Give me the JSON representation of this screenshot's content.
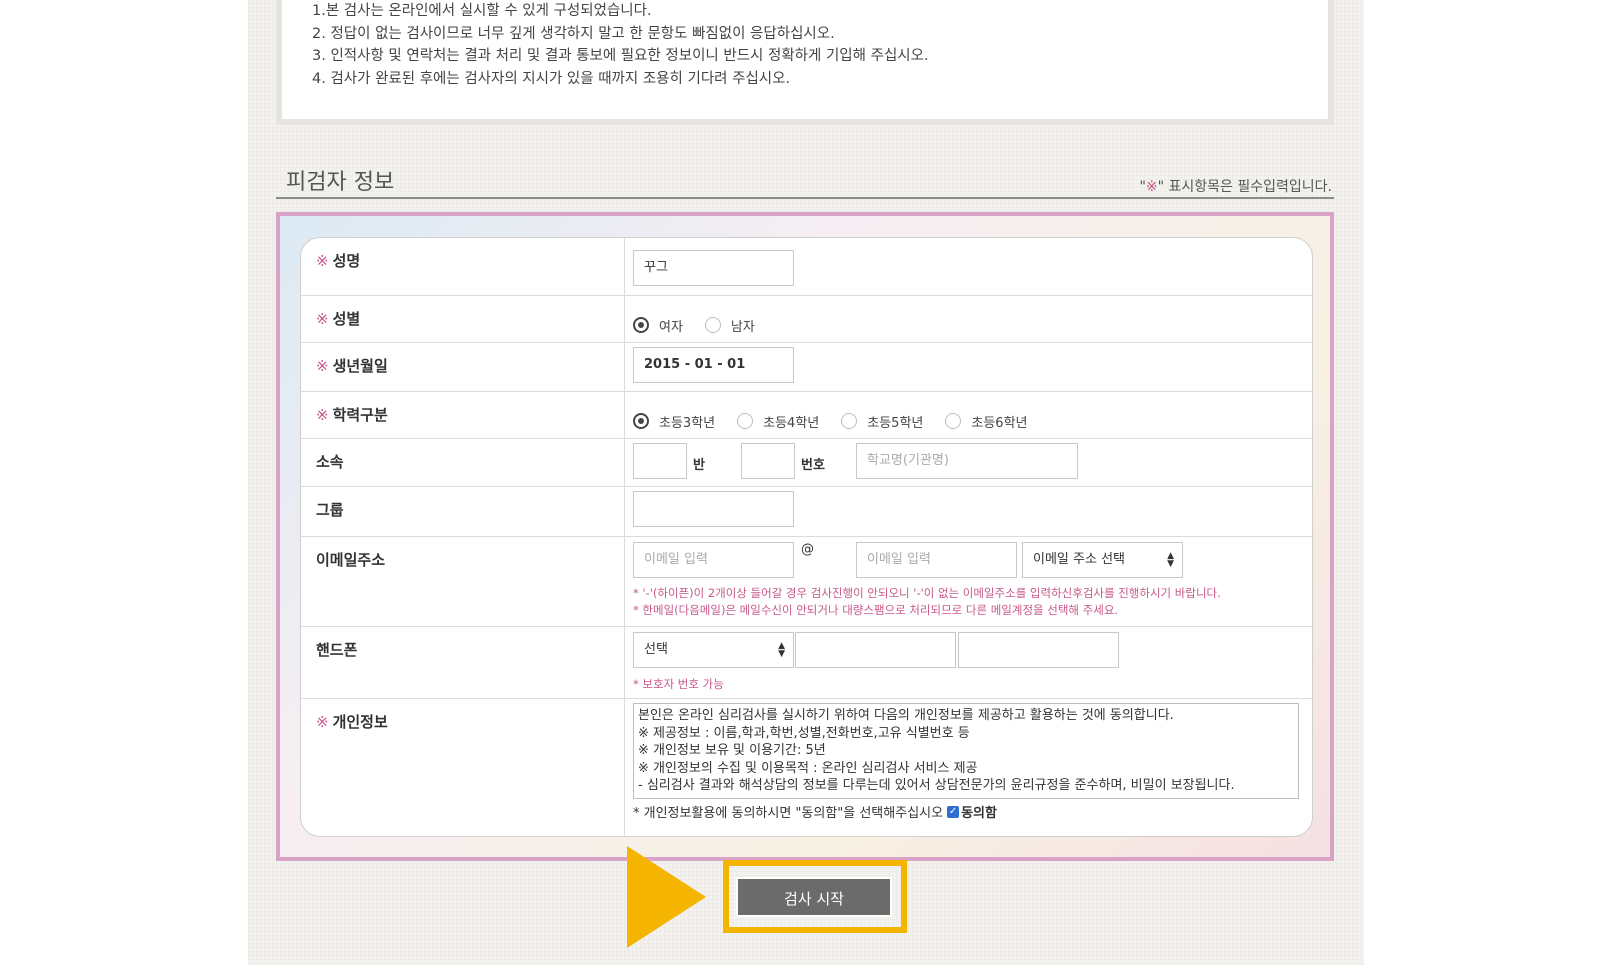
{
  "instructions": [
    "1.본 검사는 온라인에서 실시할 수 있게 구성되었습니다.",
    "2. 정답이 없는 검사이므로 너무 깊게 생각하지 말고 한 문항도 빠짐없이 응답하십시오.",
    "3. 인적사항 및 연락처는 결과 처리 및 결과 통보에 필요한 정보이니 반드시 정확하게 기입해 주십시오.",
    "4. 검사가 완료된 후에는 검사자의 지시가 있을 때까지 조용히 기다려 주십시오."
  ],
  "section": {
    "title": "피검자 정보",
    "note_prefix": "\"",
    "note_mark": "※",
    "note_suffix": "\" 표시항목은 필수입력입니다."
  },
  "required_mark": "※",
  "form": {
    "name": {
      "label": "성명",
      "value": "꾸그"
    },
    "gender": {
      "label": "성별",
      "options": [
        "여자",
        "남자"
      ],
      "selected": "여자"
    },
    "birth": {
      "label": "생년월일",
      "value": "2015 - 01 - 01"
    },
    "grade": {
      "label": "학력구분",
      "options": [
        "초등3학년",
        "초등4학년",
        "초등5학년",
        "초등6학년"
      ],
      "selected": "초등3학년"
    },
    "affiliation": {
      "label": "소속",
      "class_suffix": "반",
      "number_suffix": "번호",
      "school_placeholder": "학교명(기관명)"
    },
    "group": {
      "label": "그룹"
    },
    "email": {
      "label": "이메일주소",
      "id_placeholder": "이메일 입력",
      "at": "@",
      "domain_placeholder": "이메일 입력",
      "select_value": "이메일 주소 선택",
      "note1": "* '-'(하이픈)이 2개이상 들어갈 경우 검사진행이 안되오니 '-'이 없는 이메일주소를 입력하신후검사를 진행하시기 바랍니다.",
      "note2": "* 한메일(다음메일)은 메일수신이 안되거나 대량스팸으로 처리되므로 다른 메일계정을 선택해 주세요."
    },
    "phone": {
      "label": "핸드폰",
      "select_value": "선택",
      "note": "* 보호자 번호 가능"
    },
    "privacy": {
      "label": "개인정보",
      "lines": [
        "본인은 온라인 심리검사를 실시하기 위하여 다음의 개인정보를 제공하고 활용하는 것에 동의합니다.",
        "※ 제공정보 : 이름,학과,학번,성별,전화번호,고유 식별번호 등",
        "※ 개인정보 보유 및 이용기간: 5년",
        "※ 개인정보의 수집 및 이용목적 : 온라인 심리검사 서비스 제공",
        "- 심리검사 결과와 해석상담의 정보를 다루는데 있어서 상담전문가의 윤리규정을 준수하며, 비밀이 보장됩니다."
      ],
      "agree_text": "* 개인정보활용에 동의하시면 \"동의함\"을 선택해주십시오",
      "agree_label": "동의함",
      "agree_checked": true
    }
  },
  "start_button": {
    "label": "검사 시작"
  },
  "colors": {
    "required": "#c8588a",
    "highlight": "#f4b400",
    "button": "#6b6b6b",
    "frame": "#d9a2c7"
  },
  "icons": {
    "arrow": "play-arrow-icon",
    "select": "updown-caret-icon",
    "check": "checkmark-icon"
  }
}
